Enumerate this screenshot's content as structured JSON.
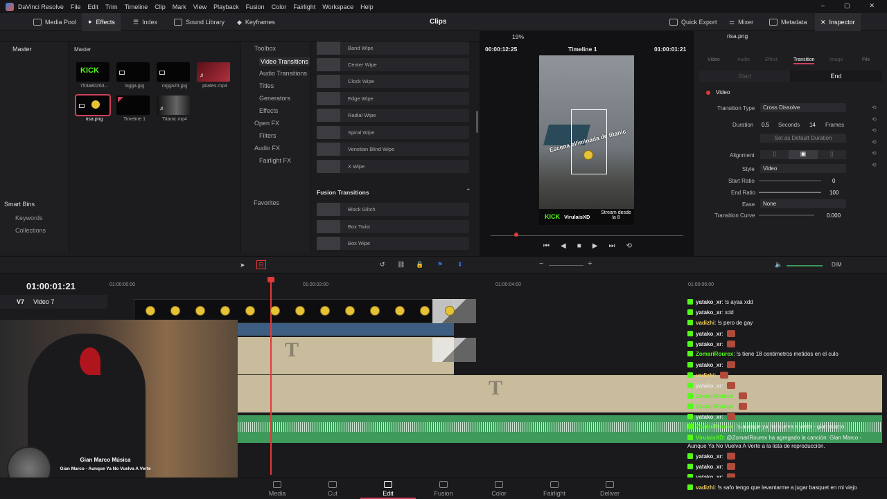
{
  "titlebar": {
    "app": "DaVinci Resolve",
    "menus": [
      "File",
      "Edit",
      "Trim",
      "Timeline",
      "Clip",
      "Mark",
      "View",
      "Playback",
      "Fusion",
      "Color",
      "Fairlight",
      "Workspace",
      "Help"
    ]
  },
  "toolbar": {
    "media_pool": "Media Pool",
    "effects": "Effects",
    "index": "Index",
    "sound_library": "Sound Library",
    "keyframes": "Keyframes",
    "center_title": "Clips",
    "quick_export": "Quick Export",
    "mixer": "Mixer",
    "metadata": "Metadata",
    "inspector": "Inspector"
  },
  "bins": {
    "master": "Master",
    "smart_bins": "Smart Bins",
    "keywords": "Keywords",
    "collections": "Collections"
  },
  "media": {
    "header": "Master",
    "clips": [
      {
        "label": "753a80263..."
      },
      {
        "label": "nigga.jpg"
      },
      {
        "label": "nigga23.jpg"
      },
      {
        "label": "pilates.mp4"
      },
      {
        "label": "risa.png"
      },
      {
        "label": "Timeline 1"
      },
      {
        "label": "Titanic.mp4"
      }
    ]
  },
  "fxtree": {
    "toolbox": "Toolbox",
    "video_transitions": "Video Transitions",
    "audio_transitions": "Audio Transitions",
    "titles": "Titles",
    "generators": "Generators",
    "effects": "Effects",
    "open_fx": "Open FX",
    "filters": "Filters",
    "audio_fx": "Audio FX",
    "fairlight_fx": "Fairlight FX",
    "favorites": "Favorites"
  },
  "fxlist": {
    "items": [
      "Band Wipe",
      "Center Wipe",
      "Clock Wipe",
      "Edge Wipe",
      "Radial Wipe",
      "Spiral Wipe",
      "Venetian Blind Wipe",
      "X Wipe"
    ],
    "fusion_header": "Fusion Transitions",
    "fusion_items": [
      "Block Glitch",
      "Box Twist",
      "Box Wipe"
    ]
  },
  "viewer": {
    "timecode_left": "00:00:12:25",
    "timeline_name": "Timeline 1",
    "timecode_right": "01:00:01:21",
    "zoom": "19%",
    "overlay_text": "Escena elliminada de titanic",
    "kick_label": "VirulaisXD",
    "stream_text": "Stream desde la 8"
  },
  "inspector": {
    "title": "risa.png",
    "tabs": [
      "Video",
      "Audio",
      "Effect",
      "Transition",
      "Image",
      "File"
    ],
    "start": "Start",
    "end": "End",
    "section": "Video",
    "transition_type_label": "Transition Type",
    "transition_type": "Cross Dissolve",
    "duration_label": "Duration",
    "duration_sec": "0.5",
    "seconds": "Seconds",
    "duration_frames": "14",
    "frames": "Frames",
    "set_default": "Set as Default Duration",
    "alignment_label": "Alignment",
    "style_label": "Style",
    "style": "Video",
    "start_ratio_label": "Start Ratio",
    "start_ratio": "0",
    "end_ratio_label": "End Ratio",
    "end_ratio": "100",
    "ease_label": "Ease",
    "ease": "None",
    "curve_label": "Transition Curve",
    "curve": "0.000"
  },
  "timeline": {
    "timecode": "01:00:01:21",
    "track_id": "V7",
    "track_name": "Video 7",
    "dim": "DIM",
    "ruler": [
      "01:00:00:00",
      "01:00:02:00",
      "01:00:04:00",
      "01:00:06:00"
    ],
    "title_glyph": "T"
  },
  "chat": [
    {
      "user": "yatako_xr",
      "msg": "!s ayaa xdd",
      "emote": false
    },
    {
      "user": "yatako_xr",
      "msg": "xdd",
      "emote": false
    },
    {
      "user": "vadizhi",
      "msg": "!s pero de gay",
      "emote": false
    },
    {
      "user": "yatako_xr",
      "msg": "",
      "emote": true
    },
    {
      "user": "yatako_xr",
      "msg": "",
      "emote": true
    },
    {
      "user": "ZomariRourex",
      "msg": "!s tiene 18 centimetros metidos en el culo",
      "emote": false
    },
    {
      "user": "yatako_xr",
      "msg": "",
      "emote": true
    },
    {
      "user": "vadizhi",
      "msg": "",
      "emote": true
    },
    {
      "user": "yatako_xr",
      "msg": "",
      "emote": true
    },
    {
      "user": "ZomariRourex",
      "msg": "",
      "emote": true
    },
    {
      "user": "ZomariRourex",
      "msg": "",
      "emote": true
    },
    {
      "user": "yatako_xr",
      "msg": "",
      "emote": true
    },
    {
      "user": "ZomariRourex",
      "msg": "!s aunque ya no vuelva a verte - gian marco",
      "emote": false
    },
    {
      "user": "VirulaisXD",
      "msg": "@ZomariRourex ha agregado la canción: Glan Marco -",
      "emote": false
    },
    {
      "user": "",
      "msg": "Aunque Ya No Vuelva A Verte a la lista de reproducción.",
      "emote": false
    },
    {
      "user": "yatako_xr",
      "msg": "",
      "emote": true
    },
    {
      "user": "yatako_xr",
      "msg": "",
      "emote": true
    },
    {
      "user": "yatako_xr",
      "msg": "",
      "emote": true
    },
    {
      "user": "vadizhi",
      "msg": "!s safo tengo que levantarme a jugar basquet en mi viejo",
      "emote": false
    }
  ],
  "now_playing": {
    "title": "Gian Marco Música",
    "track": "Gian Marco - Aunque Ya No Vuelva A Verte"
  },
  "pages": [
    "Media",
    "Cut",
    "Edit",
    "Fusion",
    "Color",
    "Fairlight",
    "Deliver"
  ],
  "colors": {
    "accent": "#d0405c",
    "kick_green": "#53fc18",
    "playhead": "#e23a3a",
    "audio_green": "#3d9a5a",
    "title_clip": "#c8bc9c"
  }
}
